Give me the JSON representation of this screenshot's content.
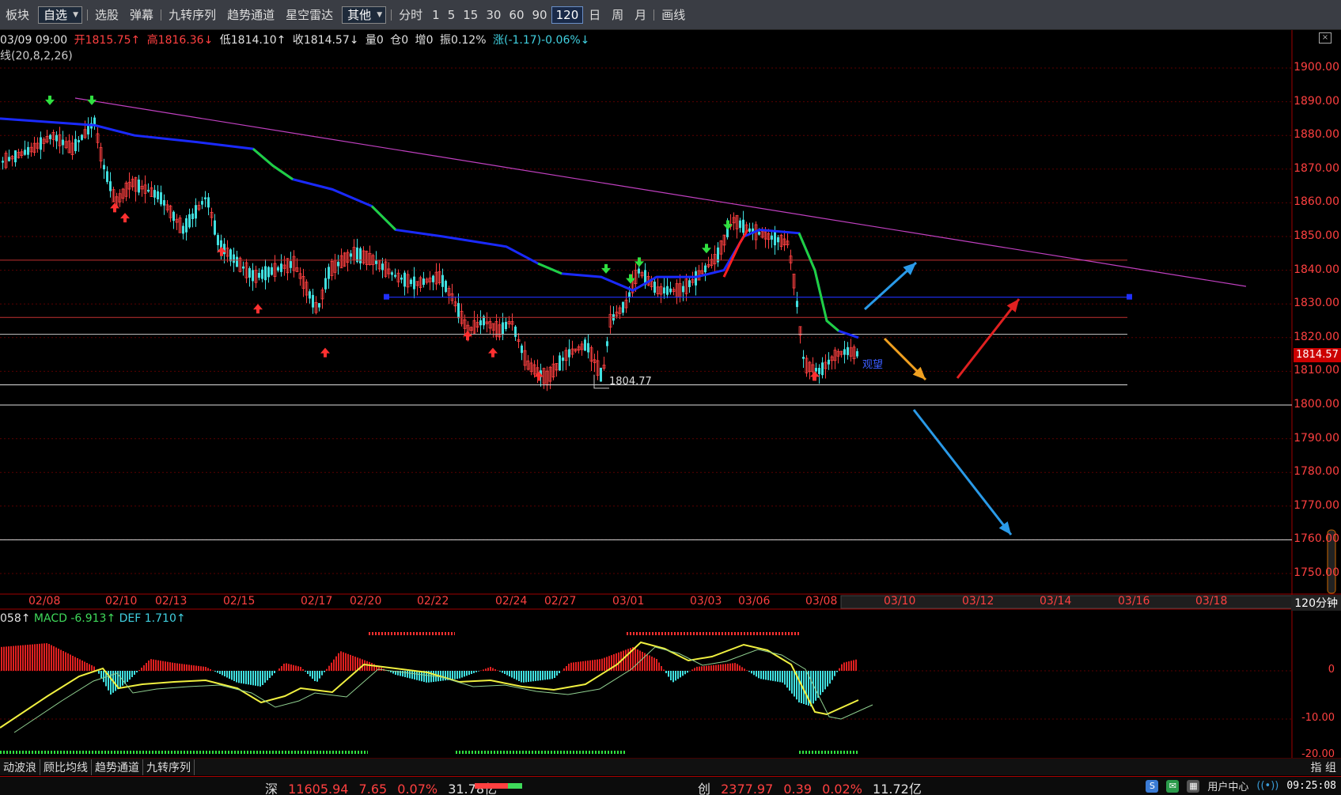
{
  "toolbar": {
    "block": "板块",
    "watchlist": "自选",
    "pick": "选股",
    "popup": "弹幕",
    "nine": "九转序列",
    "trend": "趋势通道",
    "radar": "星空雷达",
    "other": "其他",
    "intraday": "分时",
    "periods": [
      "1",
      "5",
      "15",
      "30",
      "60",
      "90",
      "120"
    ],
    "active_period": "120",
    "day": "日",
    "week": "周",
    "month": "月",
    "draw": "画线"
  },
  "info": {
    "datetime": "03/09 09:00",
    "open": "开1815.75↑",
    "high": "高1816.36↓",
    "low": "低1814.10↑",
    "close": "收1814.57↓",
    "volume": "量0",
    "position": "仓0",
    "increase": "增0",
    "amplitude": "振0.12%",
    "change": "涨(-1.17)-0.06%↓",
    "indicator": "线(20,8,2,26)"
  },
  "price_axis": [
    "1900.00",
    "1890.00",
    "1880.00",
    "1870.00",
    "1860.00",
    "1850.00",
    "1840.00",
    "1830.00",
    "1820.00",
    "1810.00",
    "1800.00",
    "1790.00",
    "1780.00",
    "1770.00",
    "1760.00",
    "1750.00"
  ],
  "current_price": "1814.57",
  "low_annotation": "1804.77",
  "observe_annotation": "观望",
  "dates": [
    "02/08",
    "02/10",
    "02/13",
    "02/15",
    "02/17",
    "02/20",
    "02/22",
    "02/24",
    "02/27",
    "03/01",
    "03/03",
    "03/06",
    "03/08"
  ],
  "future_dates": [
    "03/10",
    "03/12",
    "03/14",
    "03/16",
    "03/18"
  ],
  "period_label": "120分钟",
  "macd": {
    "prefix": "058↑",
    "macd": "MACD -6.913↑",
    "def": "DEF 1.710↑",
    "axis": [
      "0",
      "-10.00",
      "-20.00"
    ]
  },
  "bottom_tabs": [
    "动波浪",
    "顾比均线",
    "趋势通道",
    "九转序列"
  ],
  "bottom_right": "指 组",
  "status": {
    "sz_label": "深",
    "sz_index": "11605.94",
    "sz_change": "7.65",
    "sz_pct": "0.07%",
    "sz_amount": "31.78亿",
    "cy_label": "创",
    "cy_index": "2377.97",
    "cy_change": "0.39",
    "cy_pct": "0.02%",
    "cy_amount": "11.72亿",
    "user_center": "用户中心",
    "clock": "09:25:08"
  },
  "colors": {
    "up": "#ff4040",
    "down": "#40e0e0",
    "ma_blue": "#1a2aff",
    "trend_line": "#c040c0"
  }
}
